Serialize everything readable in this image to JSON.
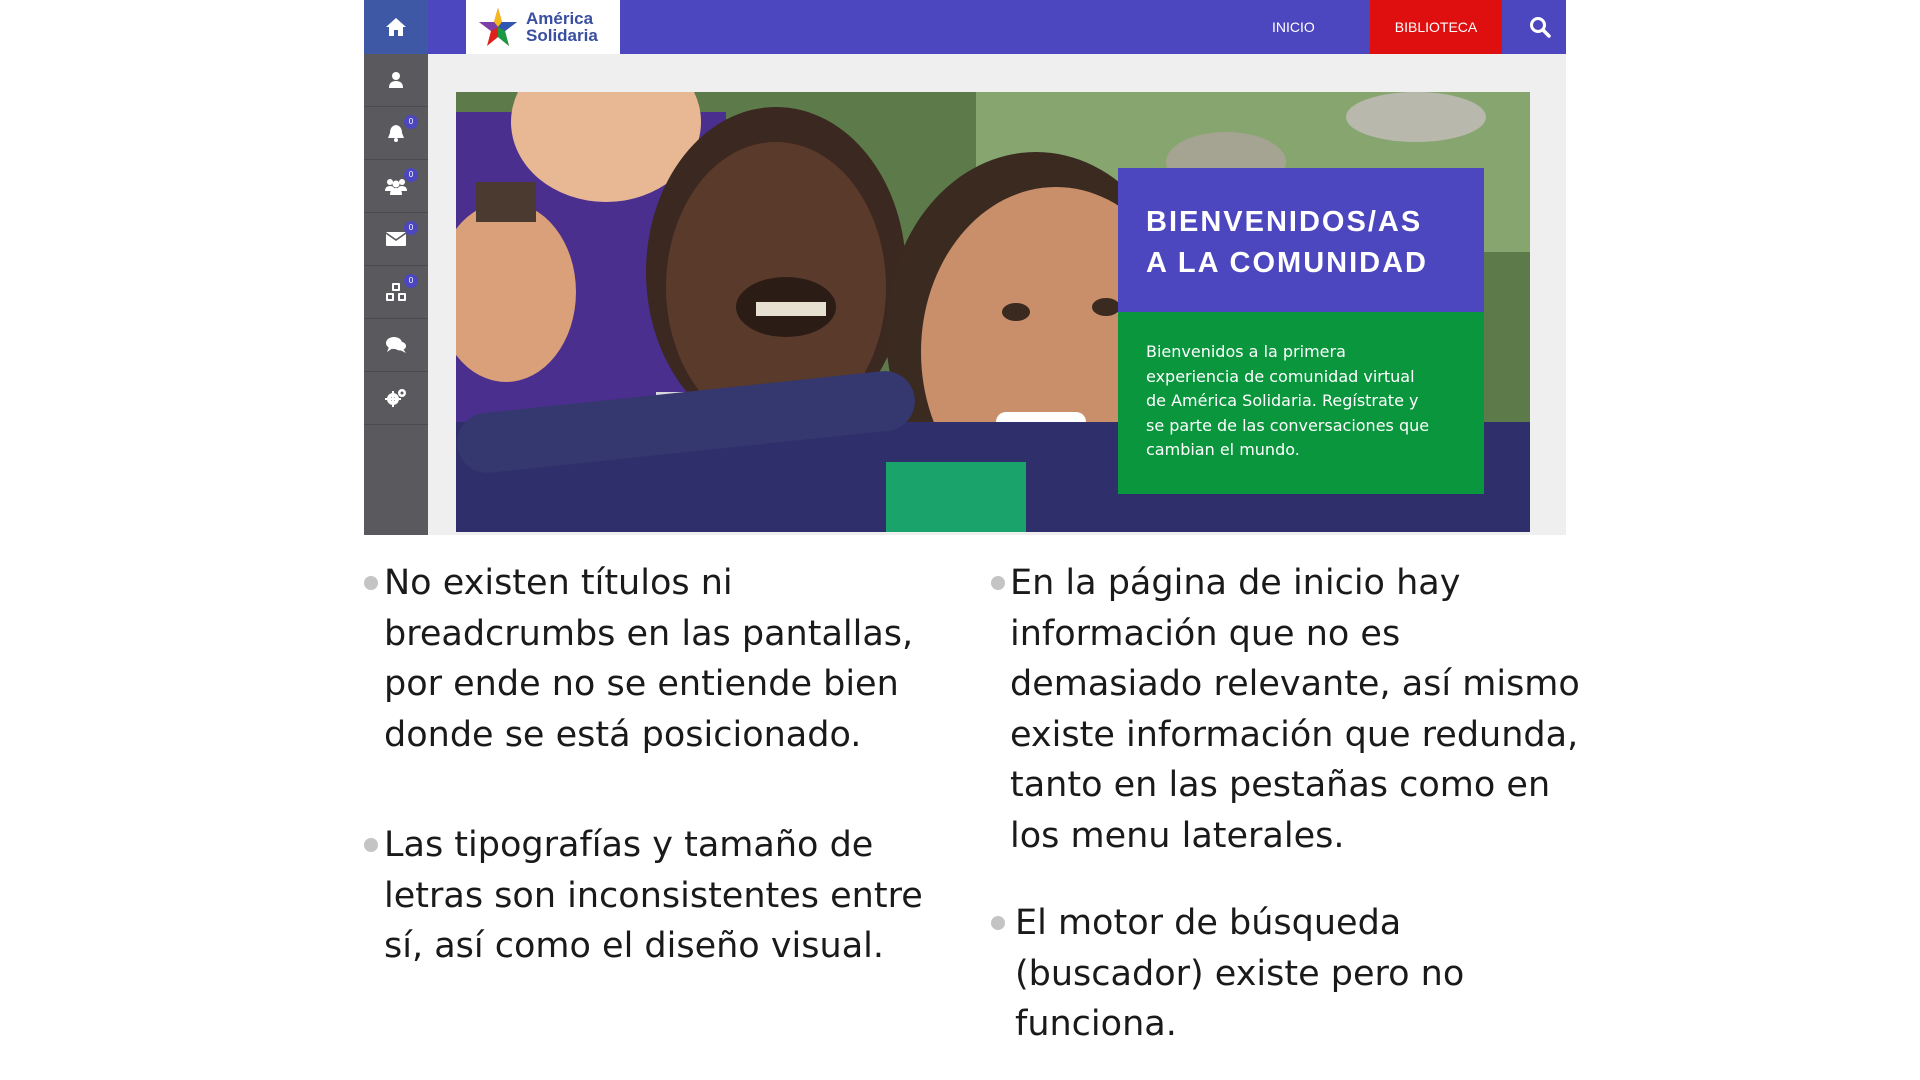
{
  "site": {
    "logo_line1": "América",
    "logo_line2": "Solidaria",
    "nav": {
      "inicio": "INICIO",
      "biblioteca": "BIBLIOTECA"
    },
    "sidebar": [
      {
        "icon": "user-icon"
      },
      {
        "icon": "bell-icon",
        "badge": "0"
      },
      {
        "icon": "group-icon",
        "badge": "0"
      },
      {
        "icon": "mail-icon",
        "badge": "0"
      },
      {
        "icon": "cubes-icon",
        "badge": "0"
      },
      {
        "icon": "chat-icon"
      },
      {
        "icon": "gears-icon"
      }
    ],
    "welcome": {
      "title_line1": "BIENVENIDOS/AS",
      "title_line2": "A LA COMUNIDAD",
      "body_lines": [
        "Bienvenidos a la primera",
        "experiencia de comunidad virtual",
        "de América Solidaria. Regístrate y",
        "se parte de las conversaciones que",
        "cambian el mundo."
      ]
    },
    "colors": {
      "header": "#4c46bf",
      "biblioteca": "#e00f0f",
      "sidebar": "#5a5a5e",
      "welcome_green": "#0a963d"
    }
  },
  "observations": {
    "left": [
      {
        "lines": [
          "No existen títulos ni",
          "breadcrumbs en las pantallas,",
          "por ende no se entiende bien",
          "donde se está posicionado."
        ]
      },
      {
        "lines": [
          "Las tipografías y tamaño de",
          "letras son inconsistentes entre",
          "sí, así como el diseño visual."
        ]
      }
    ],
    "right": [
      {
        "lines": [
          "En la página de inicio hay",
          "información que no es",
          "demasiado relevante, así mismo",
          "existe información que redunda,",
          "tanto en las pestañas como en",
          "los menu laterales."
        ]
      },
      {
        "lines": [
          "El motor de búsqueda",
          "(buscador) existe pero no",
          "funciona."
        ]
      }
    ]
  }
}
